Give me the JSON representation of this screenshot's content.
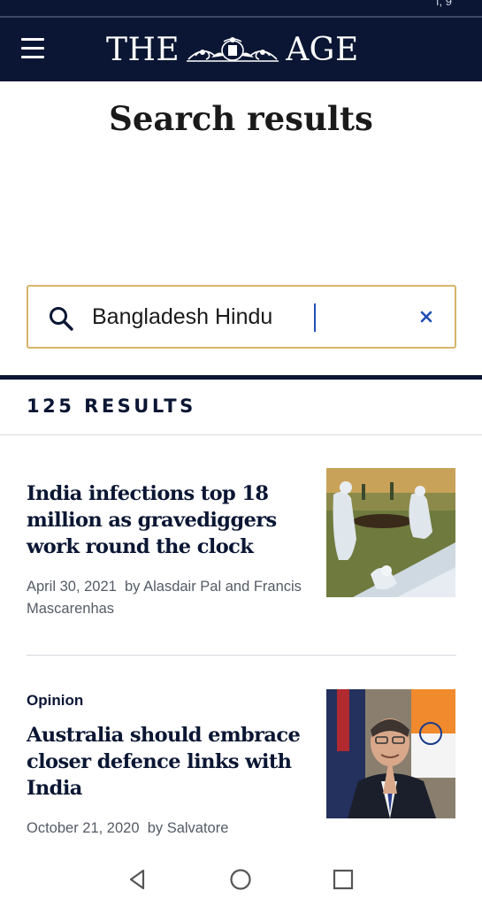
{
  "status_bar": {
    "fragment": "ı, 9"
  },
  "masthead": {
    "menu_icon": "hamburger-menu-icon",
    "logo_left": "THE",
    "logo_right": "AGE",
    "crest_icon": "coat-of-arms-icon"
  },
  "page": {
    "title": "Search results"
  },
  "search": {
    "value": "Bangladesh Hindu",
    "search_icon": "search-icon",
    "clear_icon": "close-icon"
  },
  "results": {
    "count_label": "125 RESULTS"
  },
  "articles": [
    {
      "kicker": "",
      "headline": "India infections top 18 million as gravediggers work round the clock",
      "date": "April 30, 2021",
      "byline": "by Alasdair Pal and Francis Mascarenhas"
    },
    {
      "kicker": "Opinion",
      "headline": "Australia should embrace closer defence links with India",
      "date": "October 21, 2020",
      "byline": "by Salvatore"
    }
  ],
  "nav_bar": {
    "back_icon": "back-triangle-icon",
    "home_icon": "home-circle-icon",
    "recents_icon": "recents-square-icon"
  },
  "colors": {
    "masthead_bg": "#0a1633",
    "search_border": "#d6b56a",
    "caret": "#1e4fb5"
  }
}
